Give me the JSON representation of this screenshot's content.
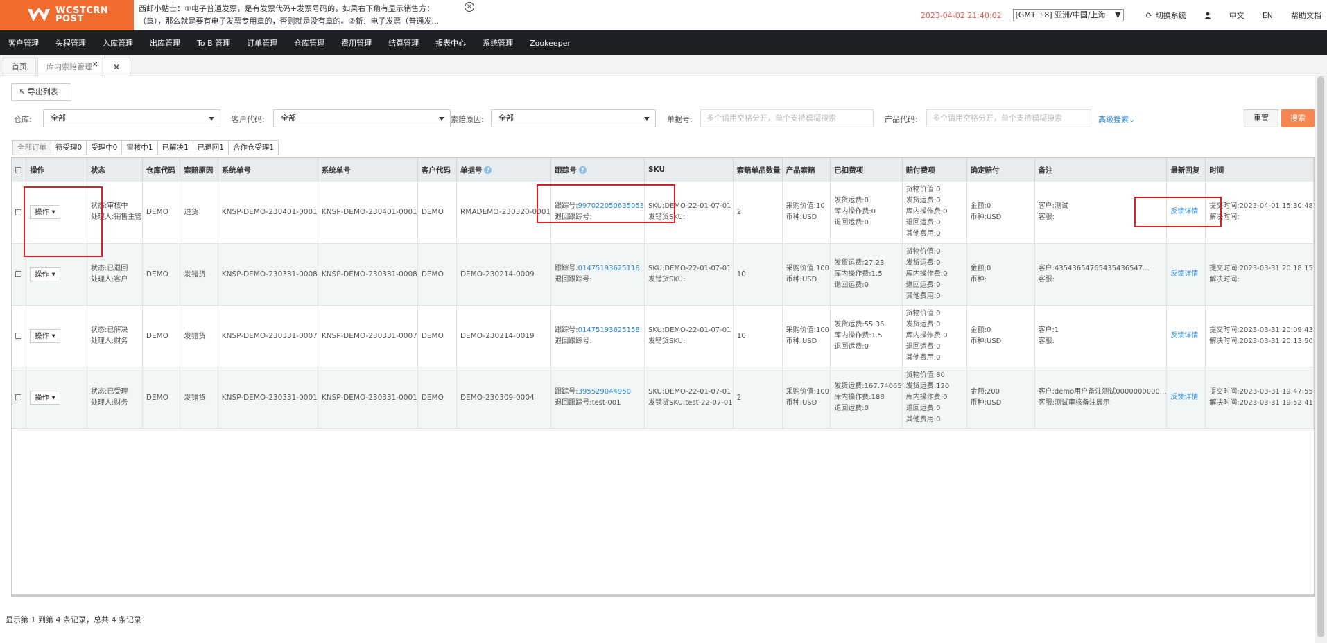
{
  "header": {
    "logo_text_line1": "WCSTCRN",
    "logo_text_line2": "POST",
    "tip_line1": "西邮小贴士：①电子普通发票，是有发票代码+发票号码的，如果右下角有显示销售方：",
    "tip_line2": "（章），那么就是要有电子发票专用章的，否则就是没有章的。②新：电子发票（普通发...",
    "datetime": "2023-04-02 21:40:02",
    "timezone": "[GMT +8] 亚洲/中国/上海",
    "switch_system": "切换系统",
    "lang_cn": "中文",
    "lang_en": "EN",
    "help": "帮助文档"
  },
  "nav": [
    "客户管理",
    "头程管理",
    "入库管理",
    "出库管理",
    "To B 管理",
    "订单管理",
    "仓库管理",
    "费用管理",
    "结算管理",
    "报表中心",
    "系统管理",
    "Zookeeper"
  ],
  "tabs": [
    {
      "label": "首页"
    },
    {
      "label": "库内索赔管理"
    }
  ],
  "toolbar": {
    "export_label": "导出列表"
  },
  "filters": {
    "warehouse_label": "仓库:",
    "warehouse_value": "全部",
    "customer_label": "客户代码:",
    "customer_value": "全部",
    "reason_label": "索赔原因:",
    "reason_value": "全部",
    "order_label": "单据号:",
    "order_placeholder": "多个请用空格分开，单个支持模糊搜索",
    "product_label": "产品代码:",
    "product_placeholder": "多个请用空格分开，单个支持模糊搜索",
    "advanced": "高级搜索",
    "reset": "重置",
    "search": "搜索"
  },
  "status_tabs": [
    "全部订单",
    "待受理0",
    "受理中0",
    "审核中1",
    "已解决1",
    "已退回1",
    "合作仓受理1"
  ],
  "table": {
    "headers": [
      "操作",
      "状态",
      "仓库代码",
      "索赔原因",
      "系统单号",
      "系统单号",
      "客户代码",
      "单据号",
      "跟踪号",
      "SKU",
      "索赔单品数量",
      "产品索赔",
      "已扣费项",
      "赔付费项",
      "确定赔付",
      "备注",
      "最新回复",
      "时间"
    ],
    "op_label": "操作",
    "reply_label": "反馈详情",
    "rows": [
      {
        "status1": "状态:审核中",
        "status2": "处理人:销售主管",
        "wh": "DEMO",
        "reason": "退货",
        "sys1": "KNSP-DEMO-230401-0001",
        "sys2": "KNSP-DEMO-230401-0001",
        "cust": "DEMO",
        "doc": "RMADEMO-230320-0001",
        "track_label": "跟踪号:",
        "track": "997022050635053",
        "return_track": "退回跟踪号:",
        "sku1": "SKU:DEMO-22-01-07-01",
        "sku2": "发错货SKU:",
        "qty": "2",
        "prod1": "采购价值:10",
        "prod2": "币种:USD",
        "ded1": "发货运费:0",
        "ded2": "库内操作费:0",
        "ded3": "退回运费:0",
        "pay1": "货物价值:0",
        "pay2": "发货运费:0",
        "pay3": "库内操作费:0",
        "pay4": "退回运费:0",
        "pay5": "其他费用:0",
        "conf1": "金额:0",
        "conf2": "币种:USD",
        "note1": "客户:测试",
        "note2": "客服:",
        "time1": "提交时间:2023-04-01 15:30:48",
        "time2": "解决时间:"
      },
      {
        "status1": "状态:已退回",
        "status2": "处理人:客户",
        "wh": "DEMO",
        "reason": "发错货",
        "sys1": "KNSP-DEMO-230331-0008",
        "sys2": "KNSP-DEMO-230331-0008",
        "cust": "DEMO",
        "doc": "DEMO-230214-0009",
        "track_label": "跟踪号:",
        "track": "01475193625118",
        "return_track": "退回跟踪号:",
        "sku1": "SKU:DEMO-22-01-07-01",
        "sku2": "发错货SKU:",
        "qty": "10",
        "prod1": "采购价值:100",
        "prod2": "币种:USD",
        "ded1": "发货运费:27.23",
        "ded2": "库内操作费:1.5",
        "ded3": "退回运费:0",
        "pay1": "货物价值:0",
        "pay2": "发货运费:0",
        "pay3": "库内操作费:0",
        "pay4": "退回运费:0",
        "pay5": "其他费用:0",
        "conf1": "金额:0",
        "conf2": "币种:",
        "note1": "客户:4354365476543543654​7...",
        "note2": "客服:",
        "time1": "提交时间:2023-03-31 20:18:15",
        "time2": "解决时间:"
      },
      {
        "status1": "状态:已解决",
        "status2": "处理人:财务",
        "wh": "DEMO",
        "reason": "发错货",
        "sys1": "KNSP-DEMO-230331-0007",
        "sys2": "KNSP-DEMO-230331-0007",
        "cust": "DEMO",
        "doc": "DEMO-230214-0019",
        "track_label": "跟踪号:",
        "track": "01475193625158",
        "return_track": "退回跟踪号:",
        "sku1": "SKU:DEMO-22-01-07-01",
        "sku2": "发错货SKU:",
        "qty": "10",
        "prod1": "采购价值:100",
        "prod2": "币种:USD",
        "ded1": "发货运费:55.36",
        "ded2": "库内操作费:1.5",
        "ded3": "退回运费:0",
        "pay1": "货物价值:0",
        "pay2": "发货运费:0",
        "pay3": "库内操作费:0",
        "pay4": "退回运费:0",
        "pay5": "其他费用:0",
        "conf1": "金额:0",
        "conf2": "币种:USD",
        "note1": "客户:1",
        "note2": "客服:",
        "time1": "提交时间:2023-03-31 20:09:43",
        "time2": "解决时间:2023-03-31 20:13:50"
      },
      {
        "status1": "状态:已受理",
        "status2": "处理人:财务",
        "wh": "DEMO",
        "reason": "发错货",
        "sys1": "KNSP-DEMO-230331-0001",
        "sys2": "KNSP-DEMO-230331-0001",
        "cust": "DEMO",
        "doc": "DEMO-230309-0004",
        "track_label": "跟踪号:",
        "track": "395529044950",
        "return_track": "退回跟踪号:test-001",
        "sku1": "SKU:DEMO-22-01-07-01",
        "sku2": "发错货SKU:test-22-07-01",
        "qty": "2",
        "prod1": "采购价值:100",
        "prod2": "币种:USD",
        "ded1": "发货运费:167.74065",
        "ded2": "库内操作费:188",
        "ded3": "退回运费:0",
        "pay1": "货物价值:80",
        "pay2": "发货运费:120",
        "pay3": "库内操作费:0",
        "pay4": "退回运费:0",
        "pay5": "其他费用:0",
        "conf1": "金额:200",
        "conf2": "币种:USD",
        "note1": "客户:demo用户备注测试0000000000...",
        "note2": "客服:测试审核备注展示",
        "time1": "提交时间:2023-03-31 19:47:55",
        "time2": "解决时间:2023-03-31 19:52:41"
      }
    ]
  },
  "footer": {
    "record_text": "显示第 1 到第 4 条记录，总共 4 条记录"
  },
  "colors": {
    "brand": "#f26b2e",
    "nav_bg": "#1c1f24",
    "link": "#2a8ad8",
    "highlight": "#e02020"
  }
}
